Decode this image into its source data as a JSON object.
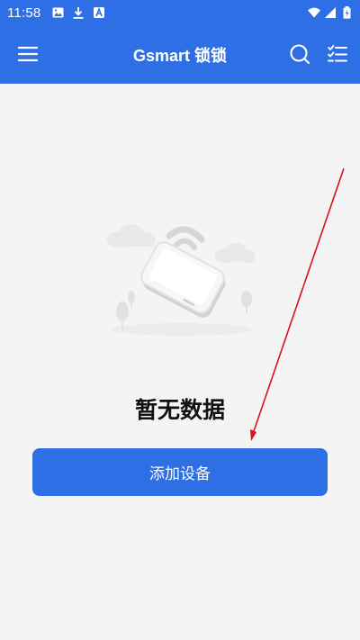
{
  "status_bar": {
    "time": "11:58",
    "left_icons": [
      "image-icon",
      "download-icon",
      "text-app-icon"
    ],
    "right_icons": [
      "wifi-icon",
      "signal-icon",
      "battery-icon"
    ]
  },
  "app_bar": {
    "title": "Gsmart 锁锁",
    "menu_icon": "menu-icon",
    "search_icon": "search-icon",
    "checklist_icon": "checklist-icon",
    "background_color": "#2f6fe5"
  },
  "empty_state": {
    "illustration": "phone-wifi-illustration",
    "message": "暂无数据"
  },
  "add_device_button": {
    "label": "添加设备",
    "color": "#2f6fe5"
  },
  "annotation": {
    "type": "arrow",
    "color": "#d9121b"
  }
}
